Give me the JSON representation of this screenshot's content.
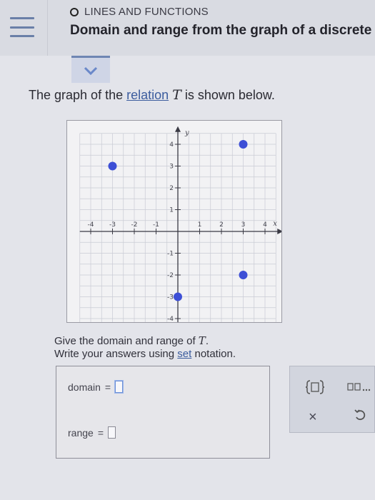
{
  "header": {
    "topic": "LINES AND FUNCTIONS",
    "title": "Domain and range from the graph of a discrete"
  },
  "prompt": {
    "before": "The graph of the ",
    "link": "relation",
    "variable": "T",
    "after": " is shown below."
  },
  "chart_data": {
    "type": "scatter",
    "xlabel": "x",
    "ylabel": "y",
    "xlim": [
      -4,
      4
    ],
    "ylim": [
      -4,
      4
    ],
    "grid": true,
    "x_ticks": [
      "-4",
      "-3",
      "-2",
      "-1",
      "1",
      "2",
      "3",
      "4"
    ],
    "y_ticks": [
      "4",
      "3",
      "2",
      "1",
      "-1",
      "-2",
      "-3",
      "-4"
    ],
    "x_tick_values": [
      -4,
      -3,
      -2,
      -1,
      1,
      2,
      3,
      4
    ],
    "y_tick_values": [
      4,
      3,
      2,
      1,
      -1,
      -2,
      -3,
      -4
    ],
    "points": [
      {
        "x": -3,
        "y": 3
      },
      {
        "x": 3,
        "y": 4
      },
      {
        "x": 3,
        "y": -2
      },
      {
        "x": 0,
        "y": -3
      }
    ],
    "point_color": "#3d4fd6"
  },
  "questions": {
    "line1_before": "Give the domain and range of ",
    "line1_var": "T",
    "line1_after": ".",
    "line2_before": "Write your answers using ",
    "line2_link": "set",
    "line2_after": " notation."
  },
  "answers": {
    "domain_label": "domain",
    "range_label": "range",
    "equals": "=",
    "domain_value": "",
    "range_value": ""
  },
  "tools": {
    "close": "×"
  },
  "colors": {
    "accent": "#6f86b3",
    "link": "#3b5c9e"
  }
}
